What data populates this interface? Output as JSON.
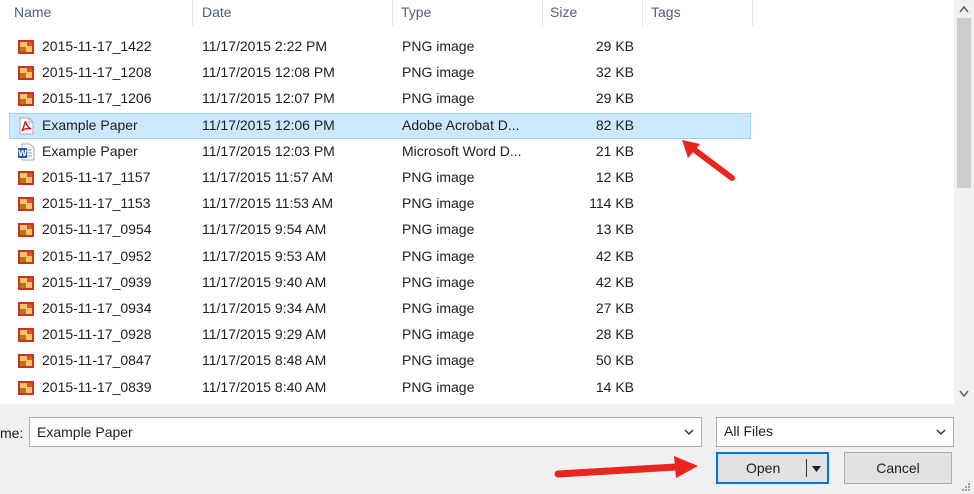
{
  "columns": {
    "name": "Name",
    "date": "Date",
    "type": "Type",
    "size": "Size",
    "tags": "Tags"
  },
  "files": [
    {
      "name": "2015-11-17_1422",
      "date": "11/17/2015 2:22 PM",
      "type": "PNG image",
      "size": "29 KB",
      "icon": "png-file-icon"
    },
    {
      "name": "2015-11-17_1208",
      "date": "11/17/2015 12:08 PM",
      "type": "PNG image",
      "size": "32 KB",
      "icon": "png-file-icon"
    },
    {
      "name": "2015-11-17_1206",
      "date": "11/17/2015 12:07 PM",
      "type": "PNG image",
      "size": "29 KB",
      "icon": "png-file-icon"
    },
    {
      "name": "Example Paper",
      "date": "11/17/2015 12:06 PM",
      "type": "Adobe Acrobat D...",
      "size": "82 KB",
      "icon": "pdf-file-icon",
      "selected": true
    },
    {
      "name": "Example Paper",
      "date": "11/17/2015 12:03 PM",
      "type": "Microsoft Word D...",
      "size": "21 KB",
      "icon": "word-file-icon"
    },
    {
      "name": "2015-11-17_1157",
      "date": "11/17/2015 11:57 AM",
      "type": "PNG image",
      "size": "12 KB",
      "icon": "png-file-icon"
    },
    {
      "name": "2015-11-17_1153",
      "date": "11/17/2015 11:53 AM",
      "type": "PNG image",
      "size": "114 KB",
      "icon": "png-file-icon"
    },
    {
      "name": "2015-11-17_0954",
      "date": "11/17/2015 9:54 AM",
      "type": "PNG image",
      "size": "13 KB",
      "icon": "png-file-icon"
    },
    {
      "name": "2015-11-17_0952",
      "date": "11/17/2015 9:53 AM",
      "type": "PNG image",
      "size": "42 KB",
      "icon": "png-file-icon"
    },
    {
      "name": "2015-11-17_0939",
      "date": "11/17/2015 9:40 AM",
      "type": "PNG image",
      "size": "42 KB",
      "icon": "png-file-icon"
    },
    {
      "name": "2015-11-17_0934",
      "date": "11/17/2015 9:34 AM",
      "type": "PNG image",
      "size": "27 KB",
      "icon": "png-file-icon"
    },
    {
      "name": "2015-11-17_0928",
      "date": "11/17/2015 9:29 AM",
      "type": "PNG image",
      "size": "28 KB",
      "icon": "png-file-icon"
    },
    {
      "name": "2015-11-17_0847",
      "date": "11/17/2015 8:48 AM",
      "type": "PNG image",
      "size": "50 KB",
      "icon": "png-file-icon"
    },
    {
      "name": "2015-11-17_0839",
      "date": "11/17/2015 8:40 AM",
      "type": "PNG image",
      "size": "14 KB",
      "icon": "png-file-icon"
    }
  ],
  "filename": {
    "label": "me:",
    "value": "Example Paper"
  },
  "filetype": {
    "value": "All Files"
  },
  "buttons": {
    "open": "Open",
    "cancel": "Cancel"
  },
  "colors": {
    "selection": "#cce8ff",
    "selection_border": "#99d1ff",
    "accent": "#0078d7",
    "annotation_arrow": "#e8261f"
  }
}
